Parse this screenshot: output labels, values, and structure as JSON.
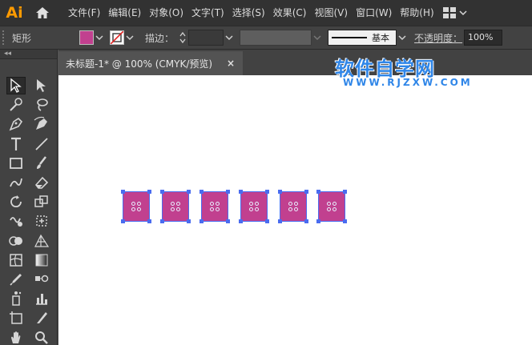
{
  "app": {
    "logo_text": "Ai",
    "brand_color": "#ff9a00"
  },
  "menu": {
    "items": [
      "文件(F)",
      "编辑(E)",
      "对象(O)",
      "文字(T)",
      "选择(S)",
      "效果(C)",
      "视图(V)",
      "窗口(W)",
      "帮助(H)"
    ]
  },
  "controlbar": {
    "selection_type": "矩形",
    "fill_color": "#c1408f",
    "stroke_label": "描边：",
    "stroke_style_label": "基本",
    "opacity_label": "不透明度：",
    "opacity_value": "100%"
  },
  "document": {
    "tab_title": "未标题-1* @ 100% (CMYK/预览)",
    "close_symbol": "×"
  },
  "canvas": {
    "object_fill": "#c1408f",
    "selection_color": "#4a6cf0",
    "objects": [
      1,
      2,
      3,
      4,
      5,
      6
    ]
  },
  "watermark": {
    "title": "软件自学网",
    "url": "WWW.RJZXW.COM"
  },
  "toolbar": {
    "collapse_symbol": "◂◂",
    "tools": [
      "selection-tool",
      "direct-selection-tool",
      "magic-wand-tool",
      "lasso-tool",
      "pen-tool",
      "curvature-tool",
      "type-tool",
      "line-segment-tool",
      "rectangle-tool",
      "paintbrush-tool",
      "shaper-tool",
      "eraser-tool",
      "rotate-tool",
      "scale-tool",
      "warp-tool",
      "free-transform-tool",
      "shape-builder-tool",
      "perspective-grid-tool",
      "mesh-tool",
      "gradient-tool",
      "eyedropper-tool",
      "blend-tool",
      "symbol-sprayer-tool",
      "column-graph-tool",
      "artboard-tool",
      "slice-tool",
      "hand-tool",
      "zoom-tool"
    ]
  }
}
